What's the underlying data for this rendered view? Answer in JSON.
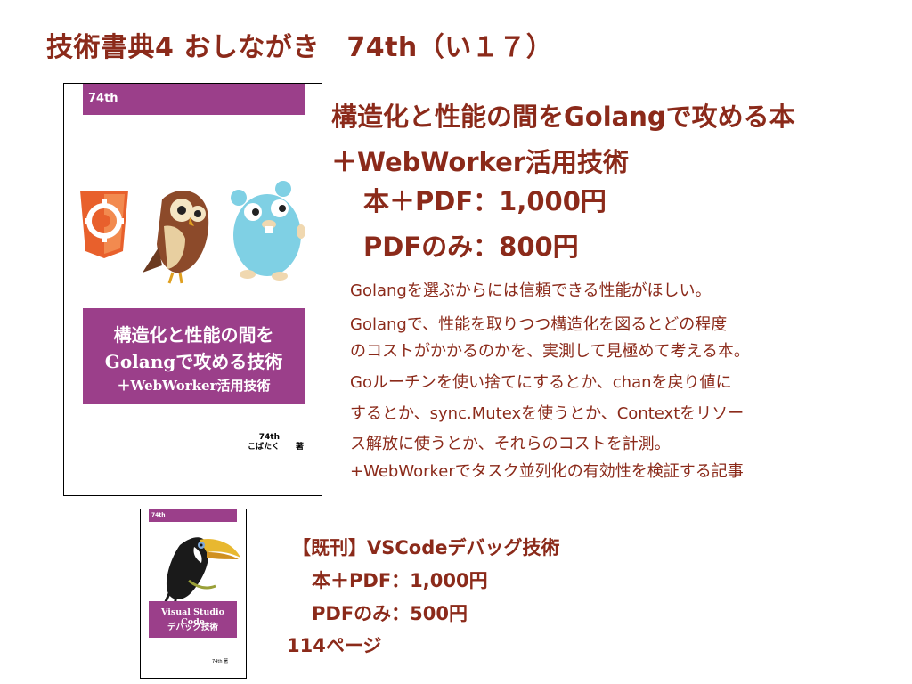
{
  "header": {
    "title": "技術書典4 おしながき　74th（い１７）"
  },
  "main_book": {
    "cover": {
      "circle_name": "74th",
      "title_line1": "構造化と性能の間を",
      "title_line2": "Golangで攻める技術",
      "title_line3": "＋WebWorker活用技術",
      "author_line1": "74th",
      "author_line2": "こばたく",
      "author_mark": "著"
    },
    "title_line1": "構造化と性能の間をGolangで攻める本",
    "title_line2": "＋WebWorker活用技術",
    "price_book_pdf": "本＋PDF：1,000円",
    "price_pdf_only": "PDFのみ：800円",
    "desc_lead": "Golangを選ぶからには信頼できる性能がほしい。",
    "desc_lines": [
      "Golangで、性能を取りつつ構造化を図るとどの程度",
      "のコストがかかるのかを、実測して見極めて考える本。",
      "Goルーチンを使い捨てにするとか、chanを戻り値に",
      "するとか、sync.Mutexを使うとか、Contextをリソー",
      "ス解放に使うとか、それらのコストを計測。",
      "+WebWorkerでタスク並列化の有効性を検証する記事"
    ]
  },
  "prev_book": {
    "cover": {
      "circle_name": "74th",
      "title_line1": "Visual Studio Code",
      "title_line2": "デバッグ技術",
      "author": "74th 著"
    },
    "title": "【既刊】VSCodeデバッグ技術",
    "price_book_pdf": "本＋PDF：1,000円",
    "price_pdf_only": "PDFのみ：500円",
    "pages": "114ページ"
  },
  "colors": {
    "text": "#8b2a1a",
    "cover_purple": "#9b3f8a"
  }
}
